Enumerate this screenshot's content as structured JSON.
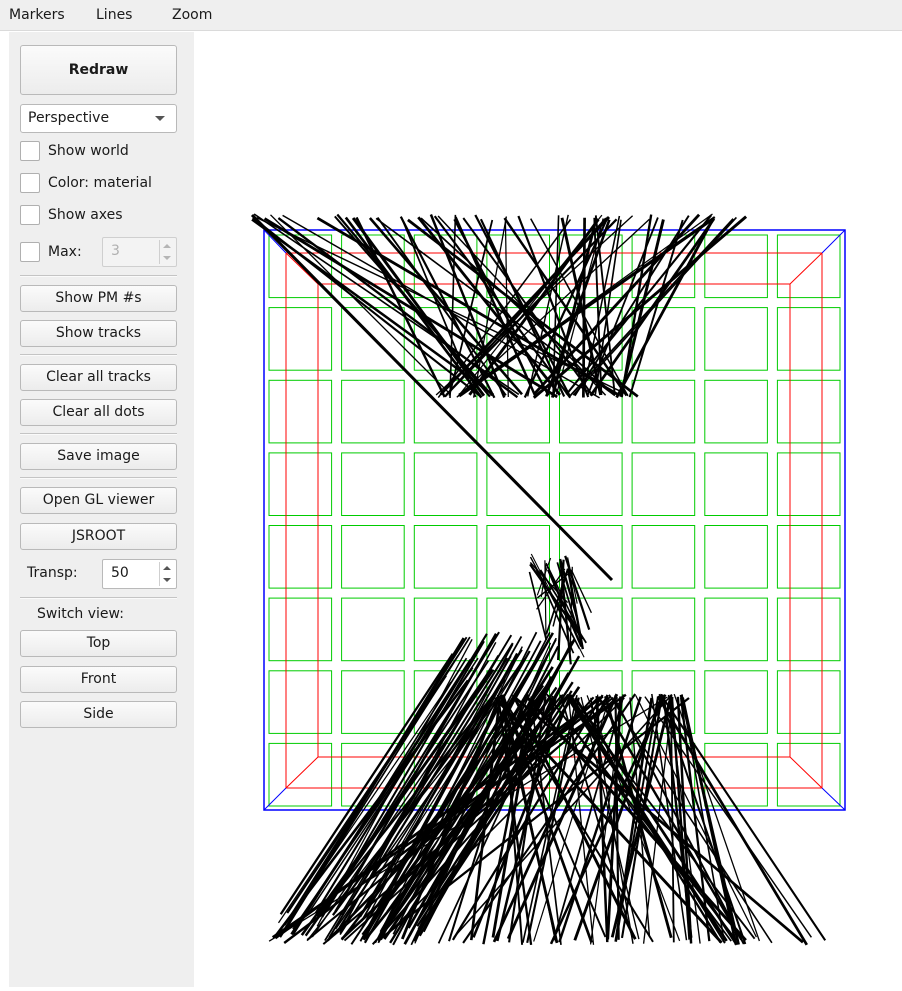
{
  "menubar": {
    "items": [
      "Markers",
      "Lines",
      "Zoom"
    ]
  },
  "sidebar": {
    "redraw_label": "Redraw",
    "projection": {
      "selected": "Perspective"
    },
    "checkboxes": [
      {
        "label": "Show world",
        "checked": false
      },
      {
        "label": "Color: material",
        "checked": false
      },
      {
        "label": "Show axes",
        "checked": false
      }
    ],
    "max": {
      "label": "Max:",
      "checked": false,
      "value": "3",
      "enabled": false
    },
    "buttons": {
      "show_pm": "Show PM #s",
      "show_tracks": "Show tracks",
      "clear_tracks": "Clear all tracks",
      "clear_dots": "Clear all dots",
      "save_image": "Save image",
      "open_gl": "Open GL viewer",
      "jsroot": "JSROOT"
    },
    "transp": {
      "label": "Transp:",
      "value": "50"
    },
    "switch_view": {
      "label": "Switch view:",
      "top": "Top",
      "front": "Front",
      "side": "Side"
    }
  },
  "viewport": {
    "colors": {
      "world_outline": "#0000ff",
      "detector_frame": "#ff0000",
      "pm_outline": "#00cc00",
      "tracks": "#000000"
    },
    "pm_grid": {
      "rows": 8,
      "cols": 8
    }
  }
}
